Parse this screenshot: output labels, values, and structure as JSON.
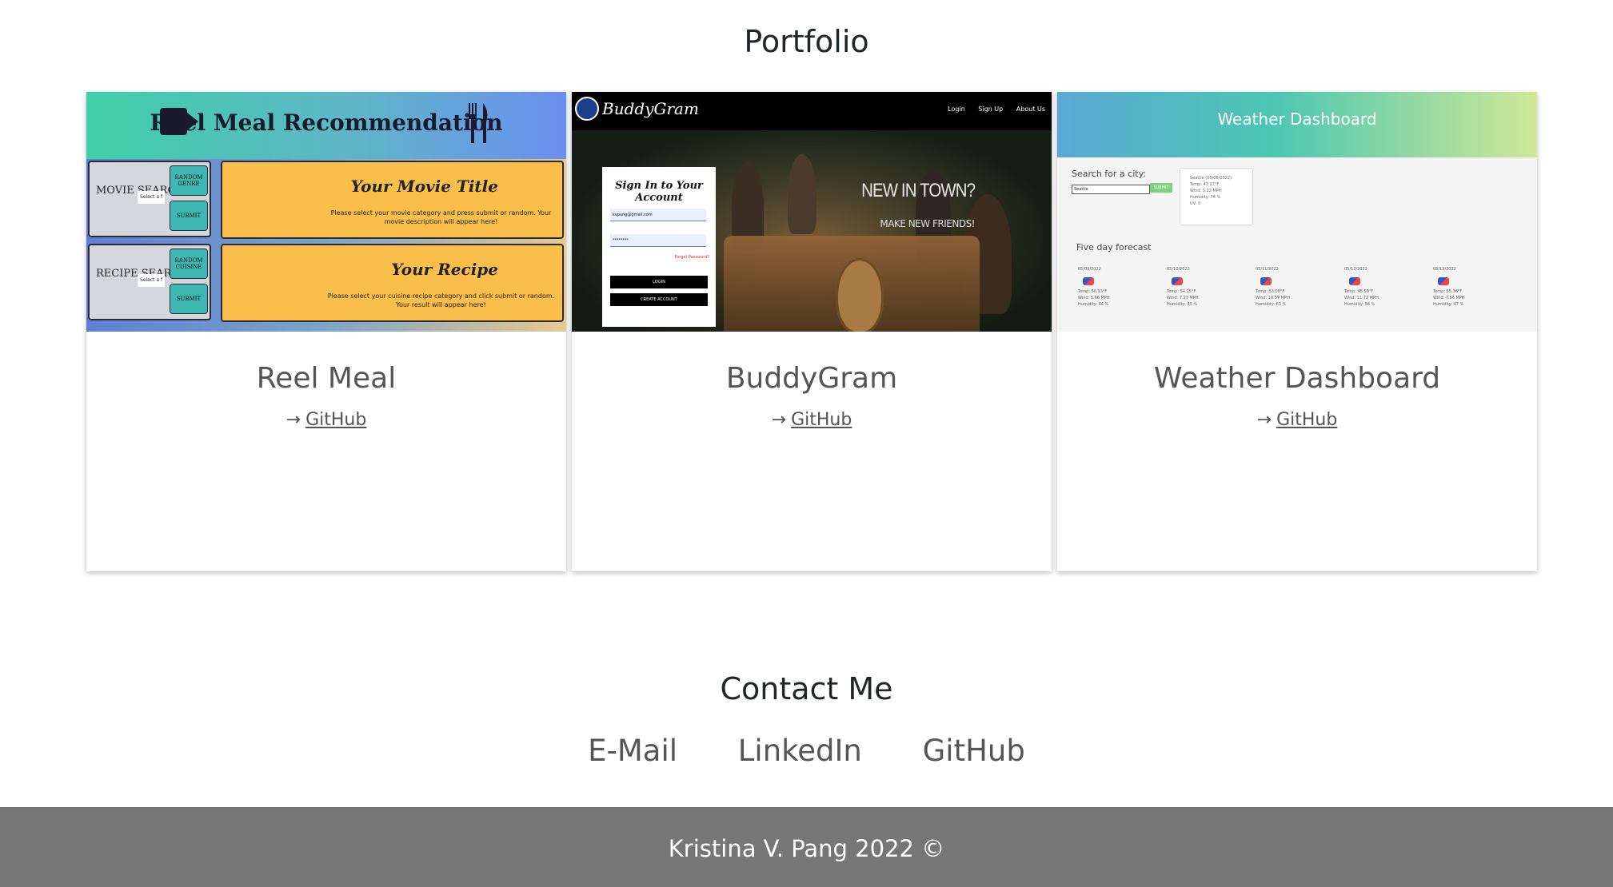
{
  "portfolio": {
    "title": "Portfolio",
    "projects": [
      {
        "name": "Reel Meal",
        "link_label": "GitHub",
        "thumbnail": {
          "title": "Reel Meal Recommendation",
          "movie_search_label": "MOVIE SEARCH",
          "recipe_search_label": "RECIPE SEARCH",
          "select_placeholder": "Select a f",
          "random_genre": "RANDOM GENRE",
          "random_cuisine": "RANDOM CUISINE",
          "submit": "SUBMIT",
          "movie_heading": "Your Movie Title",
          "movie_text": "Please select your movie category and press submit or random. Your movie description will appear here!",
          "recipe_heading": "Your Recipe",
          "recipe_text": "Please select your cuisine recipe category and click submit or random. Your result will appear here!"
        }
      },
      {
        "name": "BuddyGram",
        "link_label": "GitHub",
        "thumbnail": {
          "logo": "BuddyGram",
          "nav": [
            "Login",
            "Sign Up",
            "About Us"
          ],
          "form_title": "Sign In to Your Account",
          "email_value": "kvpang@gmail.com",
          "password_value": "********",
          "forgot": "Forgot Password?",
          "login_button": "LOGIN",
          "create_button": "CREATE ACCOUNT",
          "headline": "NEW IN TOWN?",
          "subheadline": "MAKE NEW FRIENDS!"
        }
      },
      {
        "name": "Weather Dashboard",
        "link_label": "GitHub",
        "thumbnail": {
          "title": "Weather Dashboard",
          "search_label": "Search for a city:",
          "input_value": "Seattle",
          "submit": "SUBMIT",
          "today_lines": [
            "Seattle (05/08/2022)",
            "Temp: 47.17°F",
            "Wind: 5.22 MPH",
            "Humidity: 74 %",
            "UV: 0"
          ],
          "forecast_title": "Five day forecast",
          "forecast": [
            {
              "date": "05/09/2022",
              "temp": "Temp: 56.93°F",
              "wind": "Wind: 5.66 MPH",
              "humidity": "Humidity: 44 %"
            },
            {
              "date": "05/10/2022",
              "temp": "Temp: 54.15°F",
              "wind": "Wind: 7.23 MPH",
              "humidity": "Humidity: 45 %"
            },
            {
              "date": "05/11/2022",
              "temp": "Temp: 53.08°F",
              "wind": "Wind: 10.59 MPH",
              "humidity": "Humidity: 63 %"
            },
            {
              "date": "05/12/2022",
              "temp": "Temp: 45.59°F",
              "wind": "Wind: 11.72 MPH",
              "humidity": "Humidity: 56 %"
            },
            {
              "date": "05/13/2022",
              "temp": "Temp: 55.36°F",
              "wind": "Wind: 7.56 MPH",
              "humidity": "Humidity: 47 %"
            }
          ]
        }
      }
    ]
  },
  "contact": {
    "title": "Contact Me",
    "links": [
      "E-Mail",
      "LinkedIn",
      "GitHub"
    ]
  },
  "footer": {
    "text": "Kristina V. Pang 2022 ©"
  },
  "icons": {
    "link_arrow": "arrow-right-icon"
  }
}
